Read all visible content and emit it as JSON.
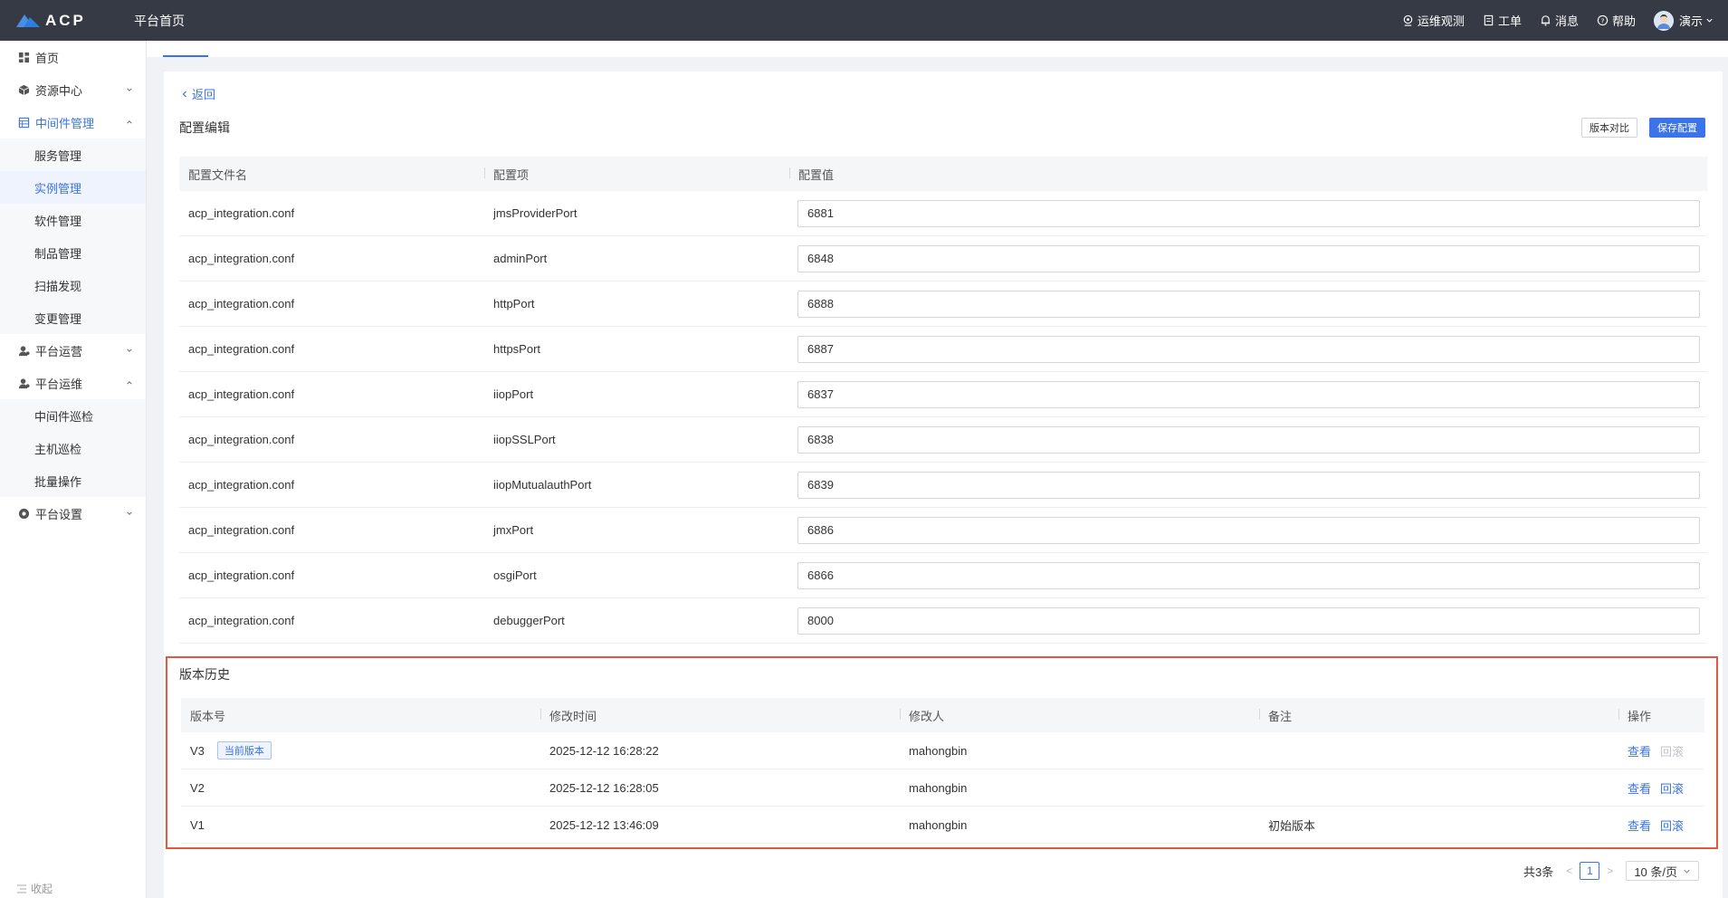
{
  "topbar": {
    "logo_text": "ACP",
    "title": "平台首页",
    "items": [
      {
        "label": "运维观测",
        "icon": "monitor-icon"
      },
      {
        "label": "工单",
        "icon": "ticket-icon"
      },
      {
        "label": "消息",
        "icon": "bell-icon"
      },
      {
        "label": "帮助",
        "icon": "help-icon"
      }
    ],
    "user": "演示"
  },
  "sidebar": {
    "items": [
      {
        "label": "首页",
        "icon": "dashboard-icon"
      },
      {
        "label": "资源中心",
        "icon": "cube-icon"
      },
      {
        "label": "中间件管理",
        "icon": "middleware-icon"
      },
      {
        "label": "服务管理"
      },
      {
        "label": "实例管理"
      },
      {
        "label": "软件管理"
      },
      {
        "label": "制品管理"
      },
      {
        "label": "扫描发现"
      },
      {
        "label": "变更管理"
      },
      {
        "label": "平台运营",
        "icon": "user-icon"
      },
      {
        "label": "平台运维",
        "icon": "user-icon"
      },
      {
        "label": "中间件巡检"
      },
      {
        "label": "主机巡检"
      },
      {
        "label": "批量操作"
      },
      {
        "label": "平台设置",
        "icon": "settings-icon"
      }
    ],
    "collapse_label": "收起"
  },
  "main": {
    "back_label": "返回",
    "config_title": "配置编辑",
    "compare_button": "版本对比",
    "save_button": "保存配置",
    "config_table": {
      "headers": [
        "配置文件名",
        "配置项",
        "配置值"
      ],
      "rows": [
        {
          "file": "acp_integration.conf",
          "key": "jmsProviderPort",
          "value": "6881"
        },
        {
          "file": "acp_integration.conf",
          "key": "adminPort",
          "value": "6848"
        },
        {
          "file": "acp_integration.conf",
          "key": "httpPort",
          "value": "6888"
        },
        {
          "file": "acp_integration.conf",
          "key": "httpsPort",
          "value": "6887"
        },
        {
          "file": "acp_integration.conf",
          "key": "iiopPort",
          "value": "6837"
        },
        {
          "file": "acp_integration.conf",
          "key": "iiopSSLPort",
          "value": "6838"
        },
        {
          "file": "acp_integration.conf",
          "key": "iiopMutualauthPort",
          "value": "6839"
        },
        {
          "file": "acp_integration.conf",
          "key": "jmxPort",
          "value": "6886"
        },
        {
          "file": "acp_integration.conf",
          "key": "osgiPort",
          "value": "6866"
        },
        {
          "file": "acp_integration.conf",
          "key": "debuggerPort",
          "value": "8000"
        }
      ]
    },
    "history_title": "版本历史",
    "history_table": {
      "headers": [
        "版本号",
        "修改时间",
        "修改人",
        "备注",
        "操作"
      ],
      "current_badge": "当前版本",
      "view_label": "查看",
      "rollback_label": "回滚",
      "rows": [
        {
          "version": "V3",
          "time": "2025-12-12 16:28:22",
          "user": "mahongbin",
          "note": ""
        },
        {
          "version": "V2",
          "time": "2025-12-12 16:28:05",
          "user": "mahongbin",
          "note": ""
        },
        {
          "version": "V1",
          "time": "2025-12-12 13:46:09",
          "user": "mahongbin",
          "note": "初始版本"
        }
      ]
    },
    "pagination": {
      "total_label": "共3条",
      "current_page": "1",
      "page_size": "10 条/页"
    }
  },
  "colors": {
    "accent": "#3b74e8",
    "topbar": "#363a45",
    "highlight_border": "#e5573f"
  }
}
